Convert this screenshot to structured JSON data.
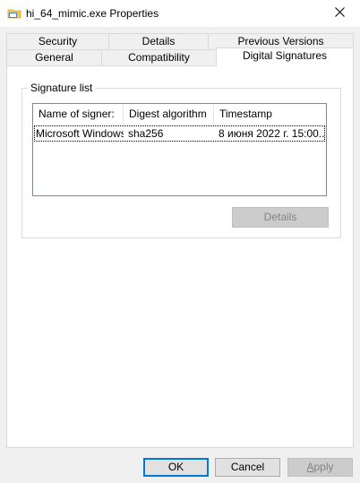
{
  "window": {
    "title": "hi_64_mimic.exe Properties"
  },
  "tabs": {
    "row_back": [
      "Security",
      "Details",
      "Previous Versions"
    ],
    "row_front": [
      "General",
      "Compatibility",
      "Digital Signatures"
    ],
    "active": "Digital Signatures"
  },
  "signature_group": {
    "label": "Signature list",
    "columns": [
      "Name of signer:",
      "Digest algorithm",
      "Timestamp"
    ],
    "rows": [
      {
        "signer": "Microsoft Windows",
        "digest": "sha256",
        "timestamp": "8 июня 2022 г. 15:00..."
      }
    ],
    "details_button": "Details"
  },
  "footer": {
    "ok": "OK",
    "cancel": "Cancel",
    "apply": "Apply"
  },
  "icons": {
    "title": "folder-exe-icon",
    "close": "close-icon"
  },
  "colors": {
    "default_button_border": "#0078d7",
    "selected_row_focus": "#000000",
    "disabled_text": "#838383"
  }
}
